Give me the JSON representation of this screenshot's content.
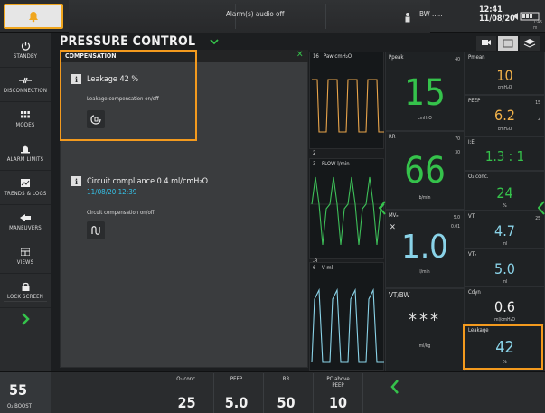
{
  "topbar": {
    "alarm_text": "Alarm(s) audio off",
    "bw_text": "BW .....",
    "time": "12:41",
    "date": "11/08/20",
    "battery_sub": "1:45 m"
  },
  "sidebar": {
    "items": [
      {
        "label": "STANDBY",
        "icon": "power-icon"
      },
      {
        "label": "DISCONNECTION",
        "icon": "disconnect-icon"
      },
      {
        "label": "MODES",
        "icon": "grid-icon"
      },
      {
        "label": "ALARM LIMITS",
        "icon": "alarm-icon"
      },
      {
        "label": "TRENDS & LOGS",
        "icon": "trends-icon"
      },
      {
        "label": "MANEUVERS",
        "icon": "maneuver-icon"
      },
      {
        "label": "VIEWS",
        "icon": "views-icon"
      },
      {
        "label": "LOCK SCREEN",
        "icon": "lock-icon"
      }
    ]
  },
  "header": {
    "title": "PRESSURE CONTROL"
  },
  "compensation": {
    "panel_title": "COMPENSATION",
    "leakage_label": "Leakage 42 %",
    "leakage_sub": "Leakage compensation on/off",
    "cc_label": "Circuit compliance 0.4 ml/cmH₂O",
    "cc_date": "11/08/20 12:39",
    "cc_sub": "Circuit compensation on/off"
  },
  "waves": [
    {
      "label": "Paw cmH₂O",
      "scale_top": "16",
      "scale_bot": "2"
    },
    {
      "label": "FLOW l/min",
      "scale_top": "3",
      "scale_bot": "-3"
    },
    {
      "label": "V ml",
      "scale_top": "6"
    }
  ],
  "params": {
    "ppeak": {
      "label": "Ppeak",
      "value": "15",
      "unit": "cmH₂O",
      "side": "40"
    },
    "rr": {
      "label": "RR",
      "value": "66",
      "unit": "b/min",
      "side_top": "70",
      "side_bot": "30"
    },
    "mve": {
      "label": "MVₑ",
      "value": "1.0",
      "unit": "l/min",
      "side_top": "5.0",
      "side_bot": "0.01"
    },
    "vtbw": {
      "label": "VT/BW",
      "value": "***",
      "unit": "ml/kg"
    },
    "pmean": {
      "label": "Pmean",
      "value": "10",
      "unit": "cmH₂O"
    },
    "peep": {
      "label": "PEEP",
      "value": "6.2",
      "unit": "cmH₂O",
      "side_top": "15",
      "side_bot": "2"
    },
    "ie": {
      "label": "I:E",
      "value": "1.3 : 1"
    },
    "o2": {
      "label": "O₂ conc.",
      "value": "24",
      "unit": "%"
    },
    "vti": {
      "label": "VTᵢ",
      "value": "4.7",
      "unit": "ml",
      "side": "25"
    },
    "vte": {
      "label": "VTₑ",
      "value": "5.0",
      "unit": "ml"
    },
    "cdyn": {
      "label": "Cdyn",
      "value": "0.6",
      "unit": "ml/cmH₂O"
    },
    "leakage": {
      "label": "Leakage",
      "value": "42",
      "unit": "%"
    }
  },
  "bottom": {
    "o2boost_value": "55",
    "o2boost_label": "O₂ BOOST",
    "cells": [
      {
        "label": "O₂ conc.",
        "value": "25"
      },
      {
        "label": "PEEP",
        "value": "5.0"
      },
      {
        "label": "RR",
        "value": "50"
      },
      {
        "label": "PC above PEEP",
        "value": "10"
      }
    ]
  }
}
